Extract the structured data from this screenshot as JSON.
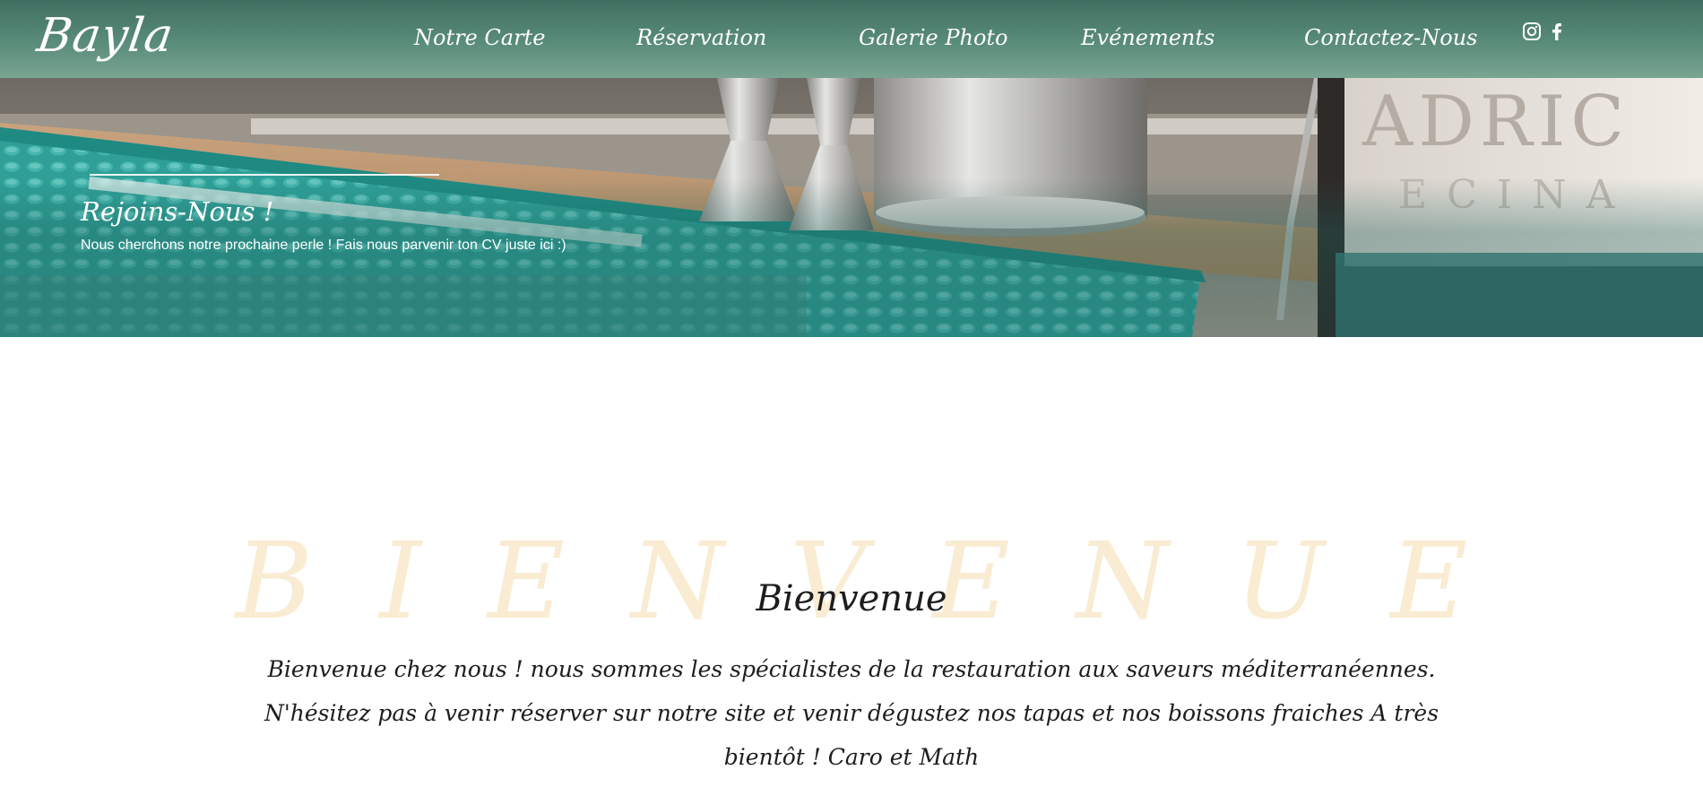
{
  "brand": {
    "logo_text": "Bayla"
  },
  "nav": {
    "items": [
      {
        "label": "Notre Carte"
      },
      {
        "label": "Réservation"
      },
      {
        "label": "Galerie Photo"
      },
      {
        "label": "Evénements"
      },
      {
        "label": "Contactez-Nous"
      }
    ],
    "social": [
      {
        "icon": "instagram-icon"
      },
      {
        "icon": "facebook-icon"
      }
    ]
  },
  "hero": {
    "title": "Rejoins-Nous !",
    "subtitle": "Nous cherchons notre prochaine perle ! Fais nous parvenir ton CV juste ici :)"
  },
  "welcome": {
    "background_word": "BIENVENUE",
    "title": "Bienvenue",
    "text": "Bienvenue chez nous ! nous sommes les spécialistes de la restauration aux saveurs méditerranéennes. N'hésitez pas à venir réserver sur notre site et venir dégustez nos tapas et nos boissons fraiches A très bientôt ! Caro et Math"
  },
  "colors": {
    "header_green": "#4e8170",
    "background_word": "#f9ecd2",
    "text_dark": "#1d1d1d"
  }
}
